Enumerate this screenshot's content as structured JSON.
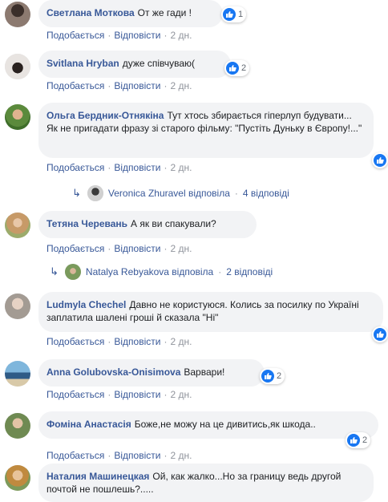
{
  "comments": [
    {
      "name": "Светлана Моткова",
      "text": "От же гади !",
      "reactions": "1",
      "like": "Подобається",
      "reply": "Відповісти",
      "time": "2 дн."
    },
    {
      "name": "Svitlana Hryban",
      "text": "дуже співчуваю(",
      "reactions": "2",
      "like": "Подобається",
      "reply": "Відповісти",
      "time": "2 дн."
    },
    {
      "name": "Ольга Бердник-Отнякіна",
      "text": "Тут хтось збирається гіперлуп будувати... Як не пригадати фразу зі старого фільму: \"Пустіть Дуньку в Європу!...\"",
      "reactions": "",
      "like": "Подобається",
      "reply": "Відповісти",
      "time": "2 дн.",
      "replies": {
        "author": "Veronica Zhuravel відповіла",
        "count": "4 відповіді"
      }
    },
    {
      "name": "Тетяна Черевань",
      "text": "А як ви спакували?",
      "like": "Подобається",
      "reply": "Відповісти",
      "time": "2 дн.",
      "replies": {
        "author": "Natalya Rebyakova відповіла",
        "count": "2 відповіді"
      }
    },
    {
      "name": "Ludmyla Chechel",
      "text": "Давно не користуюся. Колись за посилку по Україні заплатила шалені гроші й сказала \"Ні\"",
      "reactions": "",
      "like": "Подобається",
      "reply": "Відповісти",
      "time": "2 дн."
    },
    {
      "name": "Anna Golubovska-Onisimova",
      "text": "Варвари!",
      "reactions": "2",
      "like": "Подобається",
      "reply": "Відповісти",
      "time": "2 дн."
    },
    {
      "name": "Фоміна Анастасія",
      "text": "Боже,не можу на це дивитись,як шкода..",
      "reactions": "2",
      "like": "Подобається",
      "reply": "Відповісти",
      "time": "2 дн."
    },
    {
      "name": "Наталия Машинецкая",
      "text": "Ой, как жалко...Но за границу ведь другой почтой не пошлешь?.....",
      "like": "",
      "reply": "",
      "time": ""
    }
  ],
  "colors": {
    "link": "#385898",
    "bubble": "#f2f3f5",
    "like_blue": "#1877f2",
    "meta_gray": "#90949c"
  }
}
